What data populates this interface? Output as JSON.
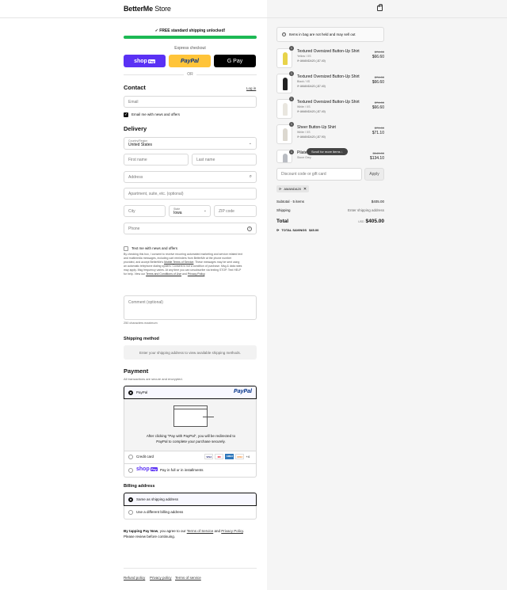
{
  "header": {
    "brand_bold": "BetterMe",
    "brand_rest": " Store"
  },
  "shipping_progress": {
    "text": "✓ FREE standard shipping unlocked!",
    "percent": 100
  },
  "express": {
    "label": "Express checkout",
    "shop_label": "shop",
    "shop_badge": "Pay",
    "paypal_label": "PayPal",
    "gpay_label": "G Pay",
    "or": "OR"
  },
  "contact": {
    "title": "Contact",
    "login": "Log in",
    "email_placeholder": "Email",
    "news_label": "Email me with news and offers"
  },
  "delivery": {
    "title": "Delivery",
    "country_label": "Country/Region",
    "country_value": "United States",
    "first_name": "First name",
    "last_name": "Last name",
    "address": "Address",
    "apartment": "Apartment, suite, etc. (optional)",
    "city": "City",
    "state_label": "State",
    "state_value": "Iowa",
    "zip": "ZIP code",
    "phone": "Phone",
    "text_label": "Text me with news and offers",
    "consent_1": "By checking this box, I consent to receive recurring automated marketing and service related text",
    "consent_2": "and multimedia messages, including cart reminders from BetterMe at the phone number",
    "consent_3a": "provided, and accept BetterMe's ",
    "consent_3b": "Mobile Terms of Service",
    "consent_3c": ". These messages may be sent using",
    "consent_4": "an automatic telephone dialing system. Consent is not a condition of purchase. Msg & data rates",
    "consent_5": "may apply. Msg frequency varies. At any time you can unsubscribe via texting STOP. Text HELP",
    "consent_6a": "for help. View our ",
    "consent_6b": "Terms and Conditions of Use",
    "consent_6c": " and ",
    "consent_6d": "Privacy Policy",
    "consent_6e": ".",
    "comment": "Comment (optional)",
    "char_limit": "250 characters maximum"
  },
  "shipping_method": {
    "title": "Shipping method",
    "note": "Enter your shipping address to view available shipping methods."
  },
  "payment": {
    "title": "Payment",
    "subtitle": "All transactions are secure and encrypted.",
    "paypal_label": "PayPal",
    "paypal_logo": "PayPal",
    "paypal_note_1": "After clicking \"Pay with PayPal\", you will be redirected to",
    "paypal_note_2": "PayPal to complete your purchase securely.",
    "card_label": "Credit card",
    "card_more": "+4",
    "cards": [
      "VISA",
      "MC",
      "AMEX",
      "DISC"
    ],
    "shoppay_logo": "shop",
    "shoppay_badge": "Pay",
    "shoppay_label": "Pay in full or in installments"
  },
  "billing": {
    "title": "Billing address",
    "same": "Same as shipping address",
    "different": "Use a different billing address"
  },
  "legal": {
    "a": "By tapping Pay Now",
    "b": ", you agree to our ",
    "c": "Terms of Service",
    "d": " and ",
    "e": "Privacy Policy",
    "f": ".",
    "g": "Please review before continuing."
  },
  "footer": {
    "refund": "Refund policy",
    "privacy": "Privacy policy",
    "terms": "Terms of service"
  },
  "summary": {
    "notice": "Items in bag are not held and may sell out",
    "items": [
      {
        "name": "Textured Oversized Button-Up Shirt",
        "variant": "Yellow / XS",
        "discount": "AMANDA20 (-$7.40)",
        "old": "$74.00",
        "new": "$66.60",
        "qty": "1",
        "color": "#e8d34a"
      },
      {
        "name": "Textured Oversized Button-Up Shirt",
        "variant": "Black / XS",
        "discount": "AMANDA20 (-$7.40)",
        "old": "$74.00",
        "new": "$66.60",
        "qty": "1",
        "color": "#222222"
      },
      {
        "name": "Textured Oversized Button-Up Shirt",
        "variant": "White / XS",
        "discount": "AMANDA20 (-$7.40)",
        "old": "$74.00",
        "new": "$66.60",
        "qty": "1",
        "color": "#e9e6df"
      },
      {
        "name": "Sheer Button-Up Shirt",
        "variant": "White / XS",
        "discount": "AMANDA20 (-$7.90)",
        "old": "$79.00",
        "new": "$71.10",
        "qty": "1",
        "color": "#dcd8d0"
      },
      {
        "name": "Pilates",
        "variant": "Stone Grey",
        "discount": "",
        "old": "$149.00",
        "new": "$134.10",
        "qty": "1",
        "color": "#b9bcc2"
      }
    ],
    "scroll_hint": "Scroll for more items ↓",
    "discount_placeholder": "Discount code or gift card",
    "apply": "Apply",
    "code": "AMANDA20",
    "subtotal_label": "Subtotal · 5 items",
    "subtotal": "$405.00",
    "shipping_label": "Shipping",
    "shipping_value": "Enter shipping address",
    "total_label": "Total",
    "currency": "USD",
    "total": "$405.00",
    "savings_label": "TOTAL SAVINGS",
    "savings": "$45.00"
  }
}
